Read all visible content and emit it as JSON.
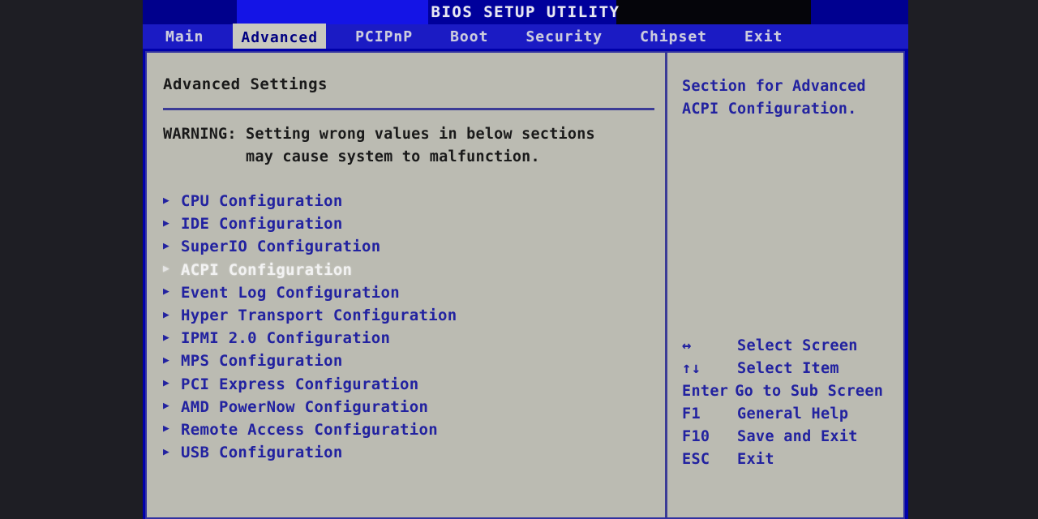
{
  "window": {
    "title": "BIOS SETUP UTILITY"
  },
  "menubar": {
    "tabs": [
      {
        "label": "Main",
        "active": false
      },
      {
        "label": "Advanced",
        "active": true
      },
      {
        "label": "PCIPnP",
        "active": false
      },
      {
        "label": "Boot",
        "active": false
      },
      {
        "label": "Security",
        "active": false
      },
      {
        "label": "Chipset",
        "active": false
      },
      {
        "label": "Exit",
        "active": false
      }
    ]
  },
  "left_panel": {
    "section_title": "Advanced Settings",
    "warning_line_1": "WARNING: Setting wrong values in below sections",
    "warning_line_2": "         may cause system to malfunction.",
    "items": [
      {
        "label": "CPU Configuration",
        "selected": false,
        "bullet": "submenu-arrow-icon"
      },
      {
        "label": "IDE Configuration",
        "selected": false,
        "bullet": "submenu-arrow-icon"
      },
      {
        "label": "SuperIO Configuration",
        "selected": false,
        "bullet": "submenu-arrow-icon"
      },
      {
        "label": "ACPI Configuration",
        "selected": true,
        "bullet": "submenu-arrow-icon"
      },
      {
        "label": "Event Log Configuration",
        "selected": false,
        "bullet": "submenu-arrow-icon"
      },
      {
        "label": "Hyper Transport Configuration",
        "selected": false,
        "bullet": "submenu-arrow-icon"
      },
      {
        "label": "IPMI 2.0 Configuration",
        "selected": false,
        "bullet": "submenu-arrow-icon"
      },
      {
        "label": "MPS Configuration",
        "selected": false,
        "bullet": "submenu-arrow-icon"
      },
      {
        "label": "PCI Express Configuration",
        "selected": false,
        "bullet": "submenu-arrow-icon"
      },
      {
        "label": "AMD PowerNow Configuration",
        "selected": false,
        "bullet": "submenu-arrow-icon"
      },
      {
        "label": "Remote Access Configuration",
        "selected": false,
        "bullet": "submenu-arrow-icon"
      },
      {
        "label": "USB Configuration",
        "selected": false,
        "bullet": "submenu-arrow-icon"
      }
    ]
  },
  "right_panel": {
    "help_text": "Section for Advanced\nACPI Configuration.",
    "keys": [
      {
        "key": "↔",
        "action": "Select Screen",
        "icon": "left-right-arrow-icon",
        "wide": false
      },
      {
        "key": "↑↓",
        "action": "Select Item",
        "icon": "up-down-arrow-icon",
        "wide": false
      },
      {
        "key": "Enter",
        "action": "Go to Sub Screen",
        "icon": "",
        "wide": true
      },
      {
        "key": "F1",
        "action": "General Help",
        "icon": "",
        "wide": false
      },
      {
        "key": "F10",
        "action": "Save and Exit",
        "icon": "",
        "wide": false
      },
      {
        "key": "ESC",
        "action": "Exit",
        "icon": "",
        "wide": false
      }
    ]
  },
  "colors": {
    "title_bar_blue": "#00009b",
    "title_bright_blue": "#1414e6",
    "menubar_blue": "#1b1bc4",
    "panel_gray": "#bbbbb2",
    "text_blue": "#2222a0",
    "rule_blue": "#3b3b96",
    "selected_white": "#f2f2f2",
    "desktop_dark": "#1e1e24"
  }
}
